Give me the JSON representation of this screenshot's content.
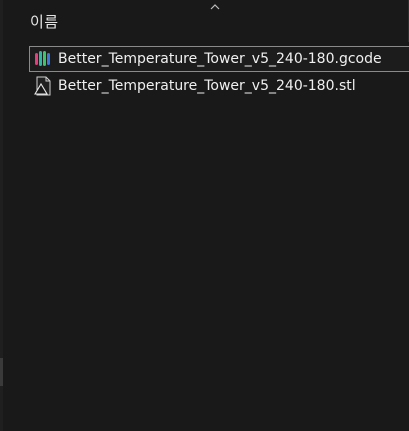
{
  "header": {
    "column_name": "이름",
    "sort_icon": "chevron-up-icon"
  },
  "files": [
    {
      "name": "Better_Temperature_Tower_v5_240-180.gcode",
      "icon": "gcode-file-icon",
      "selected": true
    },
    {
      "name": "Better_Temperature_Tower_v5_240-180.stl",
      "icon": "stl-file-icon",
      "selected": false
    }
  ],
  "colors": {
    "background": "#191919",
    "selection_border": "#8a8a8a",
    "text": "#f0f0f0"
  }
}
